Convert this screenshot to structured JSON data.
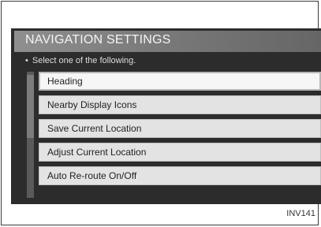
{
  "screen": {
    "title": "NAVIGATION SETTINGS",
    "prompt_bullet": "•",
    "prompt": "Select one of the following.",
    "menu_items": [
      {
        "label": "Heading"
      },
      {
        "label": "Nearby Display Icons"
      },
      {
        "label": "Save Current Location"
      },
      {
        "label": "Adjust Current Location"
      },
      {
        "label": "Auto Re-route On/Off"
      }
    ]
  },
  "figure_code": "INV141"
}
